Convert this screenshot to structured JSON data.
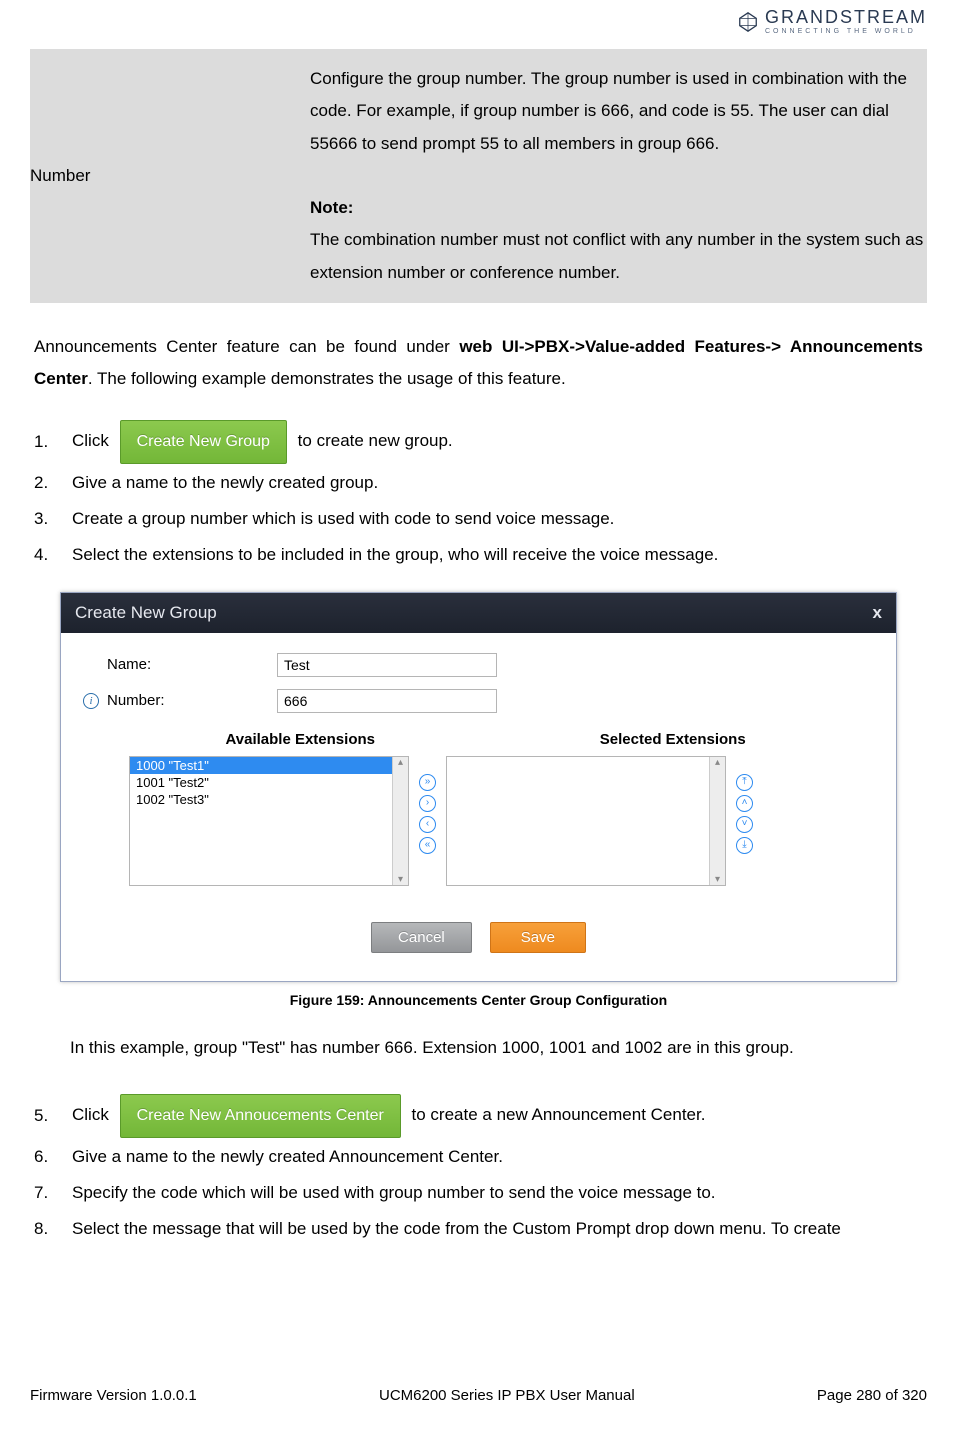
{
  "brand": {
    "name": "GRANDSTREAM",
    "tagline": "CONNECTING THE WORLD"
  },
  "param_table": {
    "label": "Number",
    "desc1": "Configure the group number. The group number is used in combination with the code. For example, if group number is 666, and code is 55. The user can dial 55666 to send prompt 55 to all members in group 666.",
    "note_label": "Note:",
    "desc2": "The combination number must not conflict with any number in the system such as extension number or conference number."
  },
  "intro": {
    "pre": "Announcements Center feature can be found under ",
    "path": "web UI->PBX->Value-added Features-> Announcements Center",
    "post": ". The following example demonstrates the usage of this feature."
  },
  "steps1": [
    {
      "n": "1.",
      "pre": "Click ",
      "btn": "Create New Group",
      "post": " to create new group."
    },
    {
      "n": "2.",
      "text": "Give a name to the newly created group."
    },
    {
      "n": "3.",
      "text": "Create a group number which is used with code to send voice message."
    },
    {
      "n": "4.",
      "text": "Select the extensions to be included in the group, who will receive the voice message."
    }
  ],
  "dialog": {
    "title": "Create New Group",
    "close": "x",
    "name_label": "Name:",
    "name_value": "Test",
    "number_label": "Number:",
    "number_value": "666",
    "available_header": "Available Extensions",
    "selected_header": "Selected Extensions",
    "available_items": [
      "1000 \"Test1\"",
      "1001 \"Test2\"",
      "1002 \"Test3\""
    ],
    "cancel": "Cancel",
    "save": "Save"
  },
  "figure_caption": "Figure 159: Announcements Center Group Configuration",
  "example_text": "In this example, group \"Test\" has number 666. Extension 1000, 1001 and 1002 are in this group.",
  "steps2": [
    {
      "n": "5.",
      "pre": "Click ",
      "btn": "Create New Annoucements Center",
      "post": " to create a new Announcement Center."
    },
    {
      "n": "6.",
      "text": "Give a name to the newly created Announcement Center."
    },
    {
      "n": "7.",
      "text": "Specify the code which will be used with group number to send the voice message to."
    },
    {
      "n": "8.",
      "text": "Select the message that will be used by the code from the Custom Prompt drop down menu. To create"
    }
  ],
  "footer": {
    "left": "Firmware Version 1.0.0.1",
    "center": "UCM6200 Series IP PBX User Manual",
    "right": "Page 280 of 320"
  }
}
